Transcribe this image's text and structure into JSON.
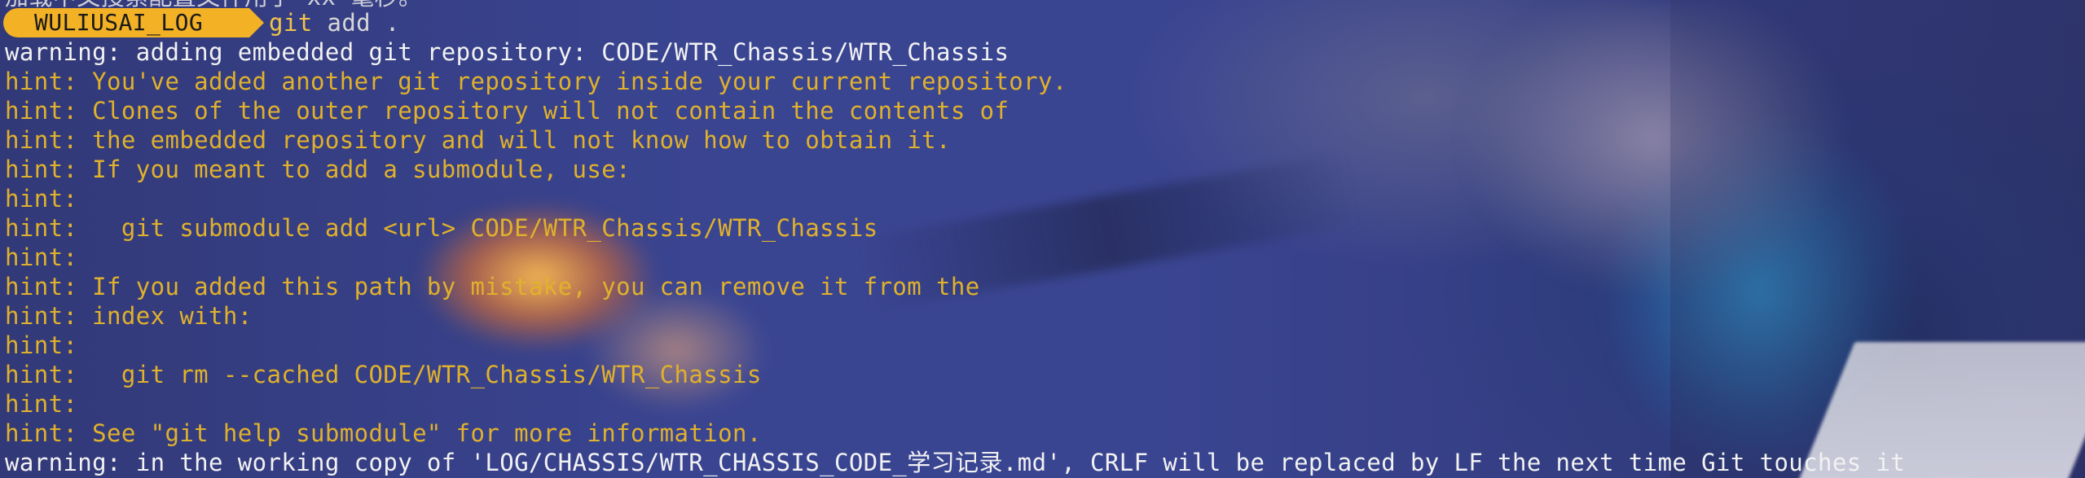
{
  "terminal": {
    "partial_line": "加载中文搜索配置文件用了 xx 毫秒。",
    "prompt": {
      "cwd_label": "WULIUSAI_LOG",
      "command_name": "git",
      "command_args": " add ."
    },
    "output": [
      {
        "type": "warning",
        "text": "warning: adding embedded git repository: CODE/WTR_Chassis/WTR_Chassis"
      },
      {
        "type": "hint",
        "text": "hint: You've added another git repository inside your current repository."
      },
      {
        "type": "hint",
        "text": "hint: Clones of the outer repository will not contain the contents of"
      },
      {
        "type": "hint",
        "text": "hint: the embedded repository and will not know how to obtain it."
      },
      {
        "type": "hint",
        "text": "hint: If you meant to add a submodule, use:"
      },
      {
        "type": "hint",
        "text": "hint:"
      },
      {
        "type": "hint",
        "text": "hint:   git submodule add <url> CODE/WTR_Chassis/WTR_Chassis"
      },
      {
        "type": "hint",
        "text": "hint:"
      },
      {
        "type": "hint",
        "text": "hint: If you added this path by mistake, you can remove it from the"
      },
      {
        "type": "hint",
        "text": "hint: index with:"
      },
      {
        "type": "hint",
        "text": "hint:"
      },
      {
        "type": "hint",
        "text": "hint:   git rm --cached CODE/WTR_Chassis/WTR_Chassis"
      },
      {
        "type": "hint",
        "text": "hint:"
      },
      {
        "type": "hint",
        "text": "hint: See \"git help submodule\" for more information."
      },
      {
        "type": "warning",
        "text": "warning: in the working copy of 'LOG/CHASSIS/WTR_CHASSIS_CODE_学习记录.md', CRLF will be replaced by LF the next time Git touches it"
      }
    ]
  },
  "colors": {
    "hint": "#e0b12c",
    "warning": "#f2f2f2",
    "prompt_badge": "#f3b126"
  }
}
